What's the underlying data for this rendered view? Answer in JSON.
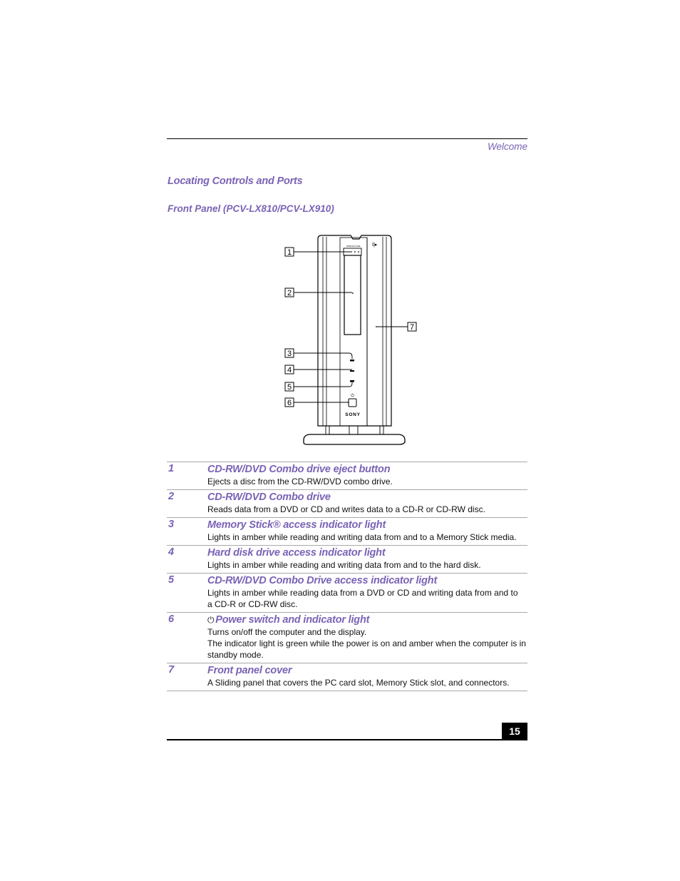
{
  "header": {
    "running_head": "Welcome"
  },
  "section": {
    "title": "Locating Controls and Ports",
    "subtitle": "Front Panel (PCV-LX810/PCV-LX910)"
  },
  "figure": {
    "callouts": [
      "1",
      "2",
      "3",
      "4",
      "5",
      "6",
      "7"
    ],
    "brand_label": "SONY"
  },
  "items": [
    {
      "num": "1",
      "title": "CD-RW/DVD Combo drive eject button",
      "desc": [
        "Ejects a disc from the CD-RW/DVD combo drive."
      ]
    },
    {
      "num": "2",
      "title": "CD-RW/DVD Combo drive",
      "desc": [
        "Reads data from a DVD or CD and writes data to a CD-R or CD-RW disc."
      ]
    },
    {
      "num": "3",
      "title": "Memory Stick® access indicator light",
      "desc": [
        "Lights in amber while reading and writing data from and to a Memory Stick media."
      ]
    },
    {
      "num": "4",
      "title": "Hard disk drive access indicator light",
      "desc": [
        "Lights in amber while reading and writing data from and to the hard disk."
      ]
    },
    {
      "num": "5",
      "title": "CD-RW/DVD Combo Drive access indicator light",
      "desc": [
        "Lights in amber while reading data from a DVD or CD and writing data from and to a CD-R or CD-RW disc."
      ]
    },
    {
      "num": "6",
      "icon": "power-icon",
      "icon_glyph": "⏻",
      "title": "Power switch and indicator light",
      "desc": [
        "Turns on/off the computer and the display.",
        "The indicator light is green while the power is on and amber when the computer is in standby mode."
      ]
    },
    {
      "num": "7",
      "title": "Front panel cover",
      "desc": [
        "A Sliding panel that covers the PC card slot, Memory Stick slot, and connectors."
      ]
    }
  ],
  "footer": {
    "page_number": "15"
  },
  "colors": {
    "heading": "#7a63b5"
  }
}
